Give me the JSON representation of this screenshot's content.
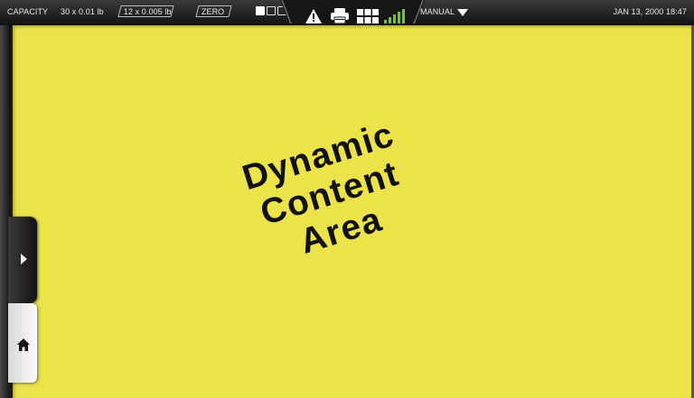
{
  "status_bar": {
    "capacity_label": "CAPACITY",
    "range_1_plain": "30 x 0.01 lb",
    "range_2_boxed": "12 x 0.005 lb",
    "zero_label": "ZERO",
    "mode_label": "MANUAL",
    "datetime": "JAN 13, 2000 18:47",
    "icons": [
      "mode-indicator-icon",
      "warning-icon",
      "printer-icon",
      "grid-menu-icon",
      "signal-strength-icon",
      "dropdown-caret-icon"
    ]
  },
  "content": {
    "line_1": "Dynamic",
    "line_2": "Content",
    "line_3": "Area",
    "background_color": "#ece24a"
  },
  "side_tabs": {
    "icons": [
      "expand-chevron-icon",
      "home-icon"
    ]
  }
}
